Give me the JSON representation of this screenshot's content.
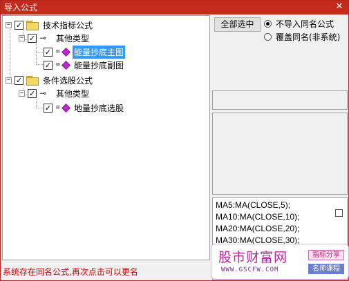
{
  "window": {
    "title": "导入公式",
    "close_glyph": "✕"
  },
  "tree": {
    "nodes": [
      {
        "label": "技术指标公式",
        "checked": true,
        "expander": "−"
      },
      {
        "label": "其他类型",
        "checked": true,
        "expander": "−"
      },
      {
        "label": "能量抄底主图",
        "checked": true,
        "selected": true
      },
      {
        "label": "能量抄底副图",
        "checked": true
      },
      {
        "label": "条件选股公式",
        "checked": true,
        "expander": "−"
      },
      {
        "label": "其他类型",
        "checked": true,
        "expander": "−"
      },
      {
        "label": "地量抄底选股",
        "checked": true
      }
    ],
    "check_glyph": "✓",
    "key_glyph": "⊸",
    "dots_glyph": "≡"
  },
  "actions": {
    "select_all_label": "全部选中",
    "radio_no_import_label": "不导入同名公式",
    "radio_overwrite_label": "覆盖同名(非系统)"
  },
  "code_lines": [
    "MA5:MA(CLOSE,5);",
    "MA10:MA(CLOSE,10);",
    "MA20:MA(CLOSE,20);",
    "MA30:MA(CLOSE,30);"
  ],
  "watermark": {
    "logo": "股市财富网",
    "url": "WWW.GSCFW.COM",
    "tag1": "指标分享",
    "tag2": "名师课程"
  },
  "status": {
    "message": "系统存在同名公式,再次点击可以更名"
  },
  "colors": {
    "titlebar": "#c42b1c",
    "selection": "#3399ff",
    "status_text": "#d00000",
    "gem": "#c026d3"
  }
}
